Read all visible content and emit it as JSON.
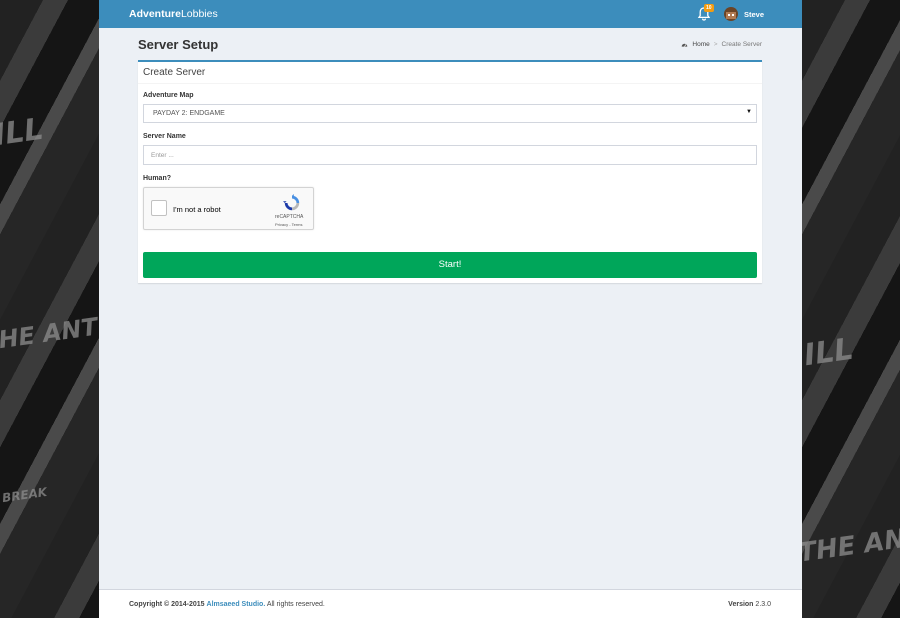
{
  "header": {
    "logo_bold": "Adventure",
    "logo_light": "Lobbies",
    "notifications_count": "10",
    "user_name": "Steve"
  },
  "page": {
    "title": "Server Setup",
    "breadcrumb": {
      "home": "Home",
      "separator": ">",
      "current": "Create Server"
    }
  },
  "form": {
    "box_title": "Create Server",
    "map_label": "Adventure Map",
    "map_selected": "PAYDAY 2: ENDGAME",
    "server_name_label": "Server Name",
    "server_name_placeholder": "Enter ...",
    "human_label": "Human?",
    "captcha": {
      "text": "I'm not a robot",
      "brand": "reCAPTCHA",
      "legal": "Privacy - Terms"
    },
    "submit_label": "Start!"
  },
  "footer": {
    "copyright_prefix": "Copyright © 2014-2015",
    "studio": "Almsaeed Studio.",
    "rights": "All rights reserved.",
    "version_label": "Version",
    "version_value": "2.3.0"
  },
  "colors": {
    "header": "#3c8dbc",
    "success": "#00a65a",
    "background": "#ecf0f5"
  },
  "icons": {
    "bell": "bell-icon",
    "breadcrumb": "dashboard-icon",
    "select": "caret-down-icon",
    "captcha": "recaptcha-icon"
  }
}
